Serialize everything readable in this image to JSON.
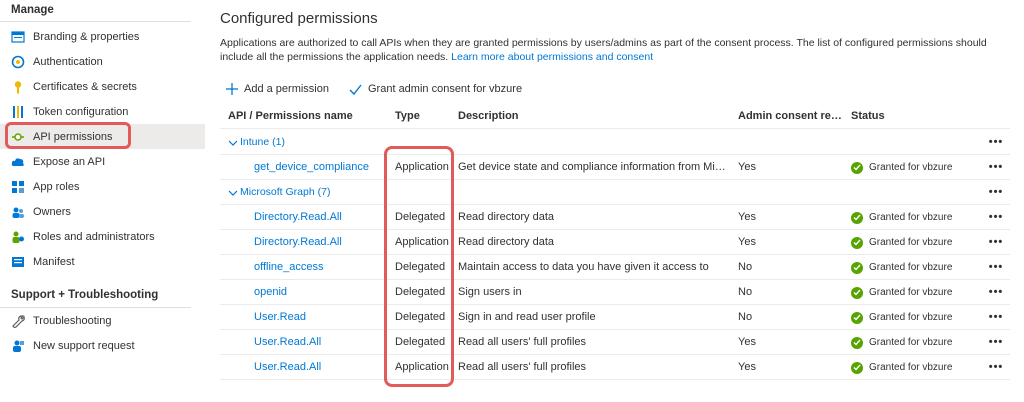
{
  "sidebar": {
    "manage_title": "Manage",
    "items": [
      {
        "label": "Branding & properties",
        "icon": "branding-icon"
      },
      {
        "label": "Authentication",
        "icon": "authentication-icon"
      },
      {
        "label": "Certificates & secrets",
        "icon": "key-icon"
      },
      {
        "label": "Token configuration",
        "icon": "token-config-icon"
      },
      {
        "label": "API permissions",
        "icon": "api-permissions-icon",
        "selected": true
      },
      {
        "label": "Expose an API",
        "icon": "cloud-icon"
      },
      {
        "label": "App roles",
        "icon": "app-roles-icon"
      },
      {
        "label": "Owners",
        "icon": "owners-icon"
      },
      {
        "label": "Roles and administrators",
        "icon": "roles-icon"
      },
      {
        "label": "Manifest",
        "icon": "manifest-icon"
      }
    ],
    "support_title": "Support + Troubleshooting",
    "support_items": [
      {
        "label": "Troubleshooting",
        "icon": "wrench-icon"
      },
      {
        "label": "New support request",
        "icon": "support-request-icon"
      }
    ]
  },
  "main": {
    "title": "Configured permissions",
    "description": "Applications are authorized to call APIs when they are granted permissions by users/admins as part of the consent process. The list of configured permissions should include all the permissions the application needs.",
    "learn_more": "Learn more about permissions and consent",
    "commands": {
      "add_permission": "Add a permission",
      "grant_consent": "Grant admin consent for vbzure"
    }
  },
  "table": {
    "headers": {
      "name": "API / Permissions name",
      "type": "Type",
      "description": "Description",
      "admin": "Admin consent requ...",
      "status": "Status"
    },
    "groups": [
      {
        "label": "Intune (1)",
        "rows": [
          {
            "name": "get_device_compliance",
            "type": "Application",
            "description": "Get device state and compliance information from Micros...",
            "admin": "Yes",
            "status": "Granted for vbzure"
          }
        ]
      },
      {
        "label": "Microsoft Graph (7)",
        "rows": [
          {
            "name": "Directory.Read.All",
            "type": "Delegated",
            "description": "Read directory data",
            "admin": "Yes",
            "status": "Granted for vbzure"
          },
          {
            "name": "Directory.Read.All",
            "type": "Application",
            "description": "Read directory data",
            "admin": "Yes",
            "status": "Granted for vbzure"
          },
          {
            "name": "offline_access",
            "type": "Delegated",
            "description": "Maintain access to data you have given it access to",
            "admin": "No",
            "status": "Granted for vbzure"
          },
          {
            "name": "openid",
            "type": "Delegated",
            "description": "Sign users in",
            "admin": "No",
            "status": "Granted for vbzure"
          },
          {
            "name": "User.Read",
            "type": "Delegated",
            "description": "Sign in and read user profile",
            "admin": "No",
            "status": "Granted for vbzure"
          },
          {
            "name": "User.Read.All",
            "type": "Delegated",
            "description": "Read all users' full profiles",
            "admin": "Yes",
            "status": "Granted for vbzure"
          },
          {
            "name": "User.Read.All",
            "type": "Application",
            "description": "Read all users' full profiles",
            "admin": "Yes",
            "status": "Granted for vbzure"
          }
        ]
      }
    ],
    "more_label": "•••"
  },
  "colors": {
    "accent": "#0078d4",
    "highlight": "#e35a5a",
    "granted": "#57a300",
    "selected_bg": "#edebe9"
  }
}
